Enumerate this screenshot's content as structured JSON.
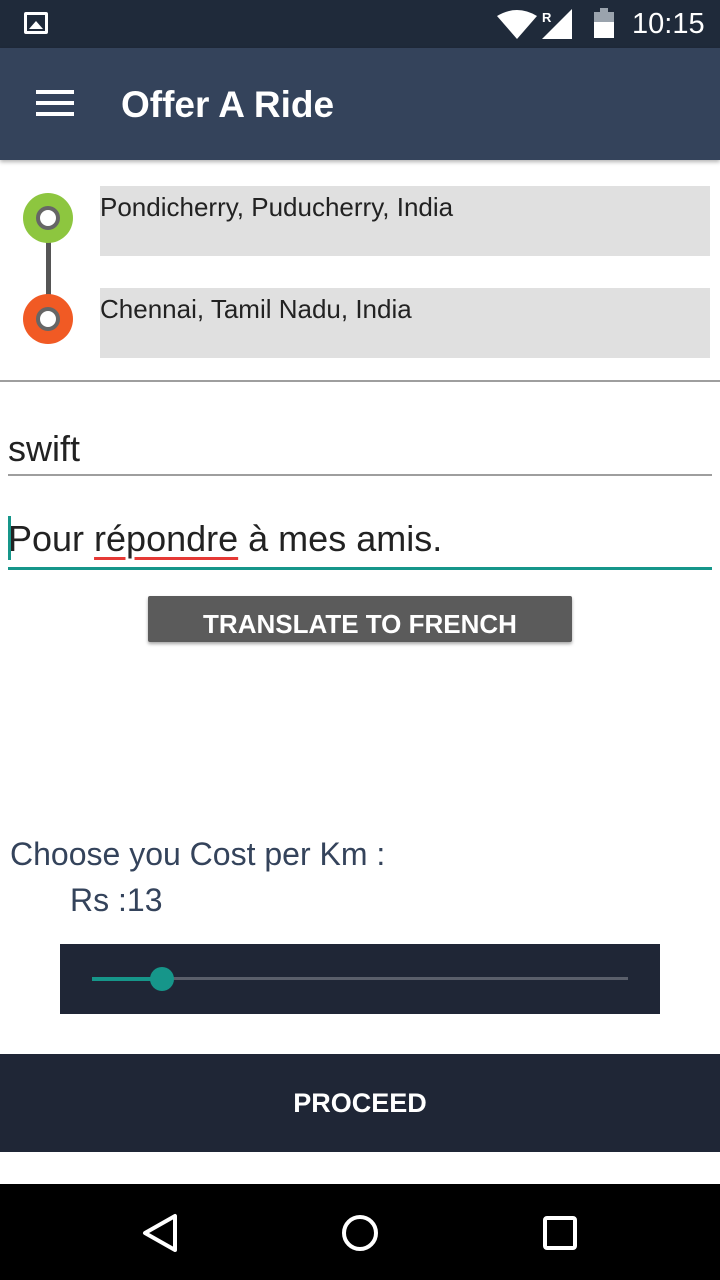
{
  "status_bar": {
    "time": "10:15",
    "icons": [
      "gallery-icon",
      "wifi-icon",
      "signal-roaming-icon",
      "battery-icon"
    ],
    "roaming_indicator": "R"
  },
  "app_bar": {
    "title": "Offer A Ride",
    "menu_icon": "hamburger-menu-icon",
    "background_color": "#34435b"
  },
  "route": {
    "from": "Pondicherry, Puducherry, India",
    "to": "Chennai, Tamil Nadu, India",
    "origin_color": "#8dc63f",
    "destination_color": "#f15a24"
  },
  "form": {
    "car_value": "swift",
    "message_value_prefix": "Pour ",
    "message_value_misspelled": "répondre",
    "message_value_suffix": " à mes amis.",
    "translate_button": "TRANSLATE TO FRENCH"
  },
  "cost": {
    "label": "Choose you Cost per Km :",
    "value_text": "Rs :13",
    "slider_fraction": 0.13,
    "accent_color": "#16968a"
  },
  "actions": {
    "proceed": "PROCEED"
  },
  "nav_bar": {
    "icons": [
      "back-icon",
      "home-icon",
      "recents-icon"
    ]
  }
}
